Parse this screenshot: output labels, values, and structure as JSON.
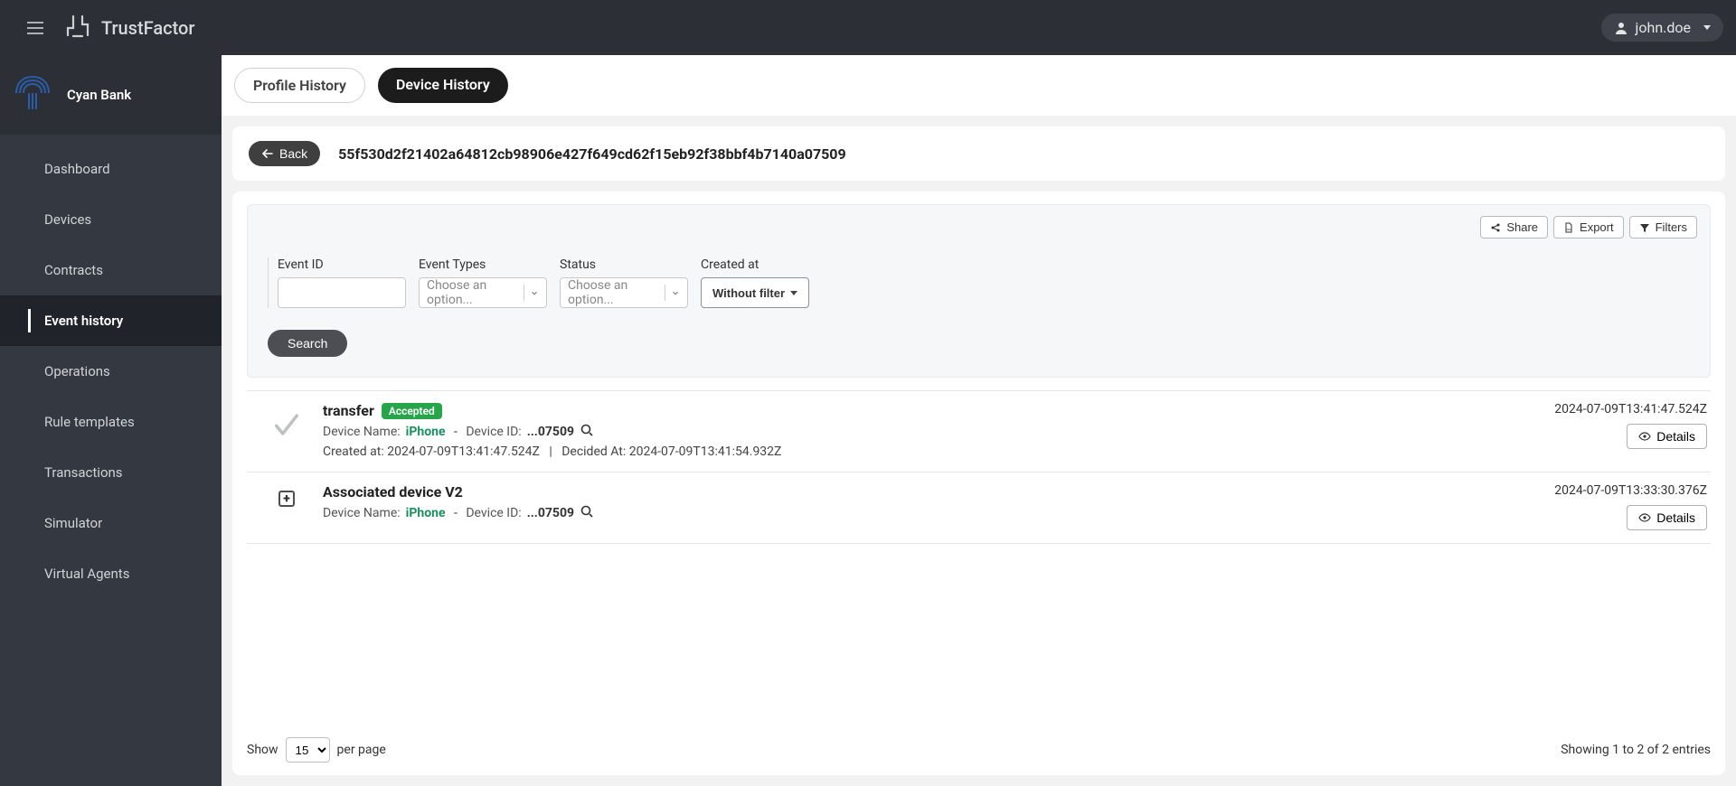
{
  "header": {
    "brand": "TrustFactor",
    "user": "john.doe"
  },
  "sidebar": {
    "org": "Cyan Bank",
    "items": [
      {
        "label": "Dashboard"
      },
      {
        "label": "Devices"
      },
      {
        "label": "Contracts"
      },
      {
        "label": "Event history",
        "active": true
      },
      {
        "label": "Operations"
      },
      {
        "label": "Rule templates"
      },
      {
        "label": "Transactions"
      },
      {
        "label": "Simulator"
      },
      {
        "label": "Virtual Agents"
      }
    ]
  },
  "tabs": {
    "profile": "Profile History",
    "device": "Device History"
  },
  "crumb": {
    "back_label": "Back",
    "id": "55f530d2f21402a64812cb98906e427f649cd62f15eb92f38bbf4b7140a07509"
  },
  "toolbar": {
    "share": "Share",
    "export": "Export",
    "filters": "Filters"
  },
  "filters": {
    "event_id_label": "Event ID",
    "event_types_label": "Event Types",
    "event_types_placeholder": "Choose an option...",
    "status_label": "Status",
    "status_placeholder": "Choose an option...",
    "created_at_label": "Created at",
    "without_filter": "Without filter",
    "search": "Search"
  },
  "events": [
    {
      "kind": "check",
      "title": "transfer",
      "badge": "Accepted",
      "device_name_label": "Device Name:",
      "device_name": "iPhone",
      "device_id_label": "Device ID:",
      "device_id_short": "...07509",
      "created_at_label": "Created at:",
      "created_at": "2024-07-09T13:41:47.524Z",
      "decided_at_label": "Decided At:",
      "decided_at": "2024-07-09T13:41:54.932Z",
      "timestamp": "2024-07-09T13:41:47.524Z",
      "details_label": "Details"
    },
    {
      "kind": "plus",
      "title": "Associated device V2",
      "device_name_label": "Device Name:",
      "device_name": "iPhone",
      "device_id_label": "Device ID:",
      "device_id_short": "...07509",
      "timestamp": "2024-07-09T13:33:30.376Z",
      "details_label": "Details"
    }
  ],
  "pager": {
    "show_label": "Show",
    "per_page_value": "15",
    "per_page_label": "per page",
    "summary": "Showing 1 to 2 of 2 entries"
  }
}
